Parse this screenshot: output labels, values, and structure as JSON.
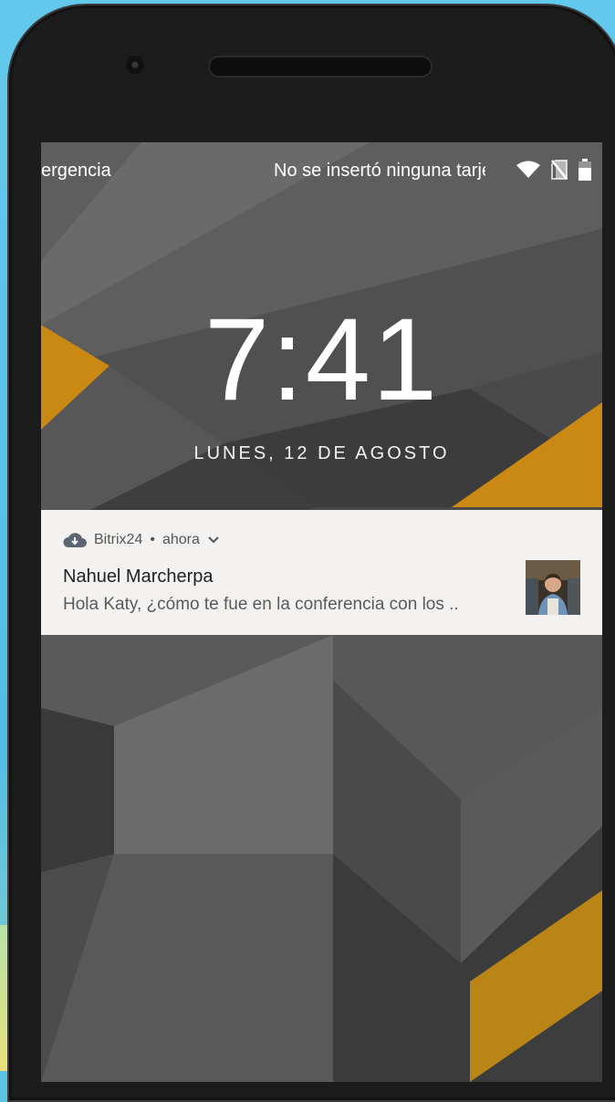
{
  "status_bar": {
    "left_text": "ergencia",
    "right_text": "No se insertó ninguna tarjeta SIM",
    "icons": [
      "wifi-icon",
      "no-sim-icon",
      "battery-icon"
    ]
  },
  "lockscreen": {
    "time": "7:41",
    "date": "LUNES, 12 DE AGOSTO"
  },
  "notification": {
    "app_name": "Bitrix24",
    "separator": "•",
    "time": "ahora",
    "title": "Nahuel Marcherpa",
    "body": "Hola Katy, ¿cómo te fue en la conferencia con los ..",
    "app_icon": "cloud-icon",
    "expand_icon": "chevron-down-icon",
    "avatar": "avatar"
  },
  "colors": {
    "notification_bg": "#f3f2f0",
    "wallpaper_accent": "#c98912",
    "wallpaper_base": "#444444"
  }
}
